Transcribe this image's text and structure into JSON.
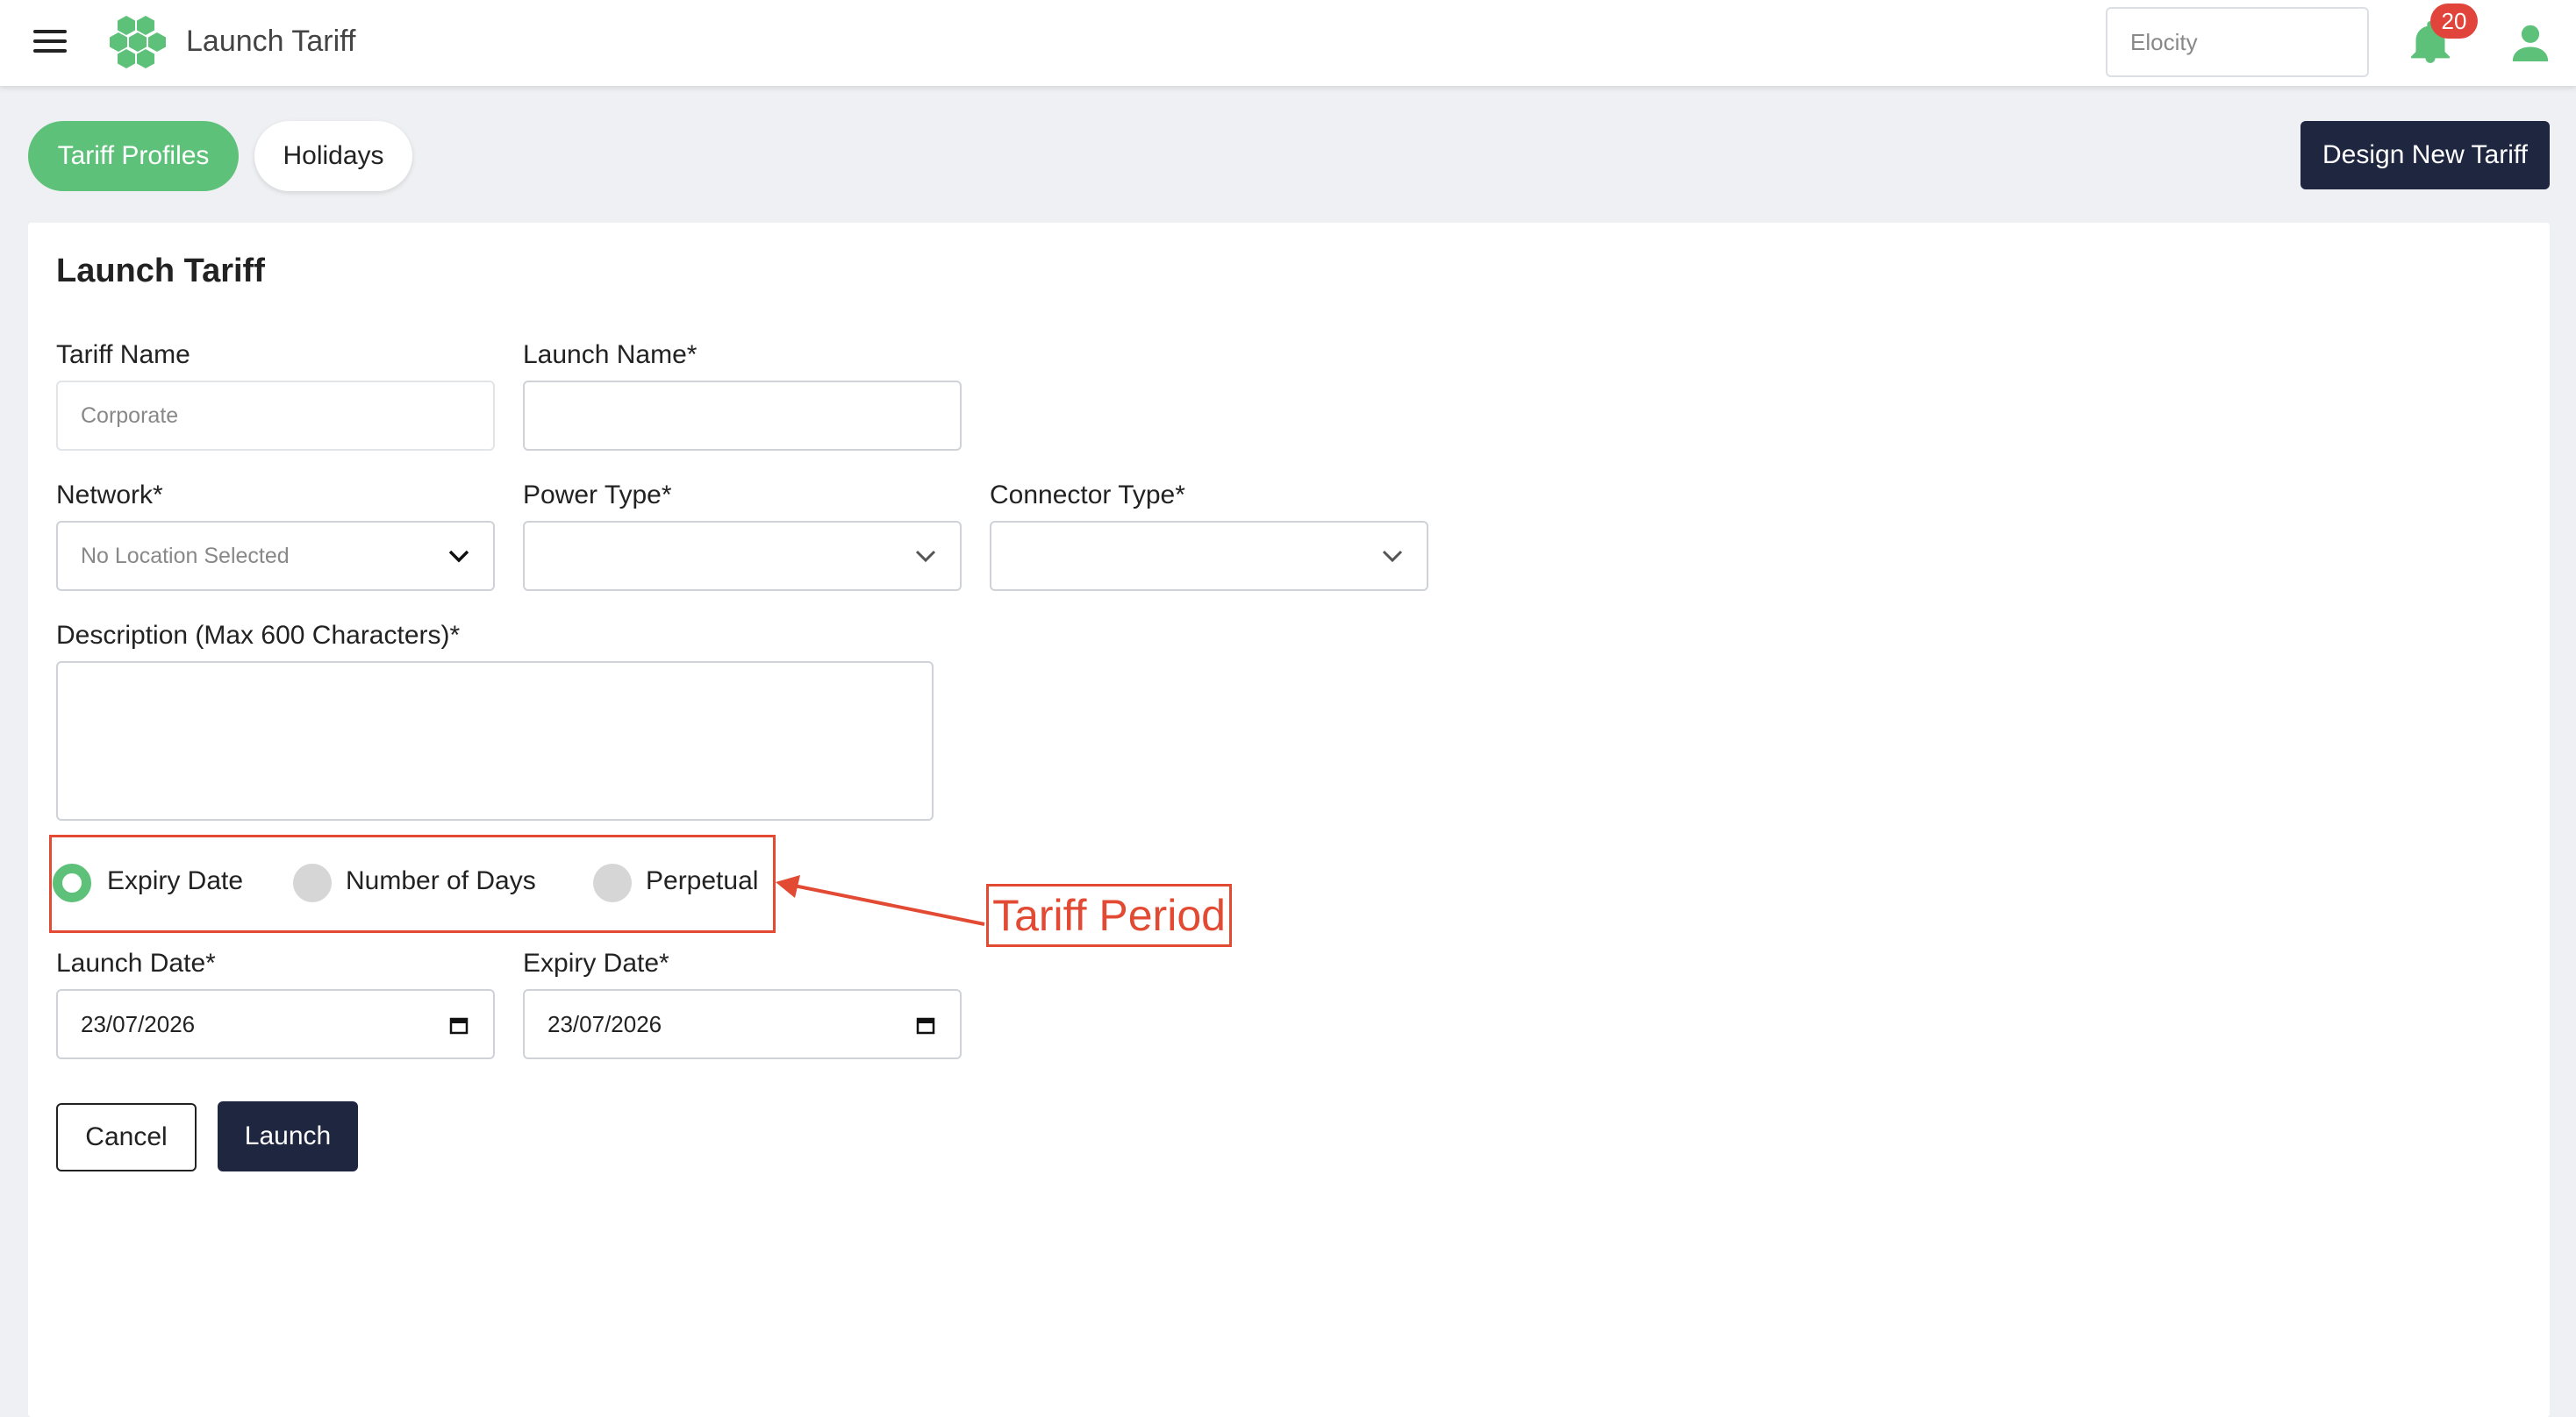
{
  "header": {
    "app_title": "Launch Tariff",
    "company_selector": "Elocity",
    "notification_count": "20",
    "icons": [
      "hamburger-menu-icon",
      "hexagon-logo-icon",
      "bell-icon",
      "user-icon"
    ]
  },
  "tabs": [
    {
      "label": "Tariff Profiles",
      "active": true
    },
    {
      "label": "Holidays",
      "active": false
    }
  ],
  "actions": {
    "design_new_tariff": "Design New Tariff"
  },
  "form": {
    "title": "Launch Tariff",
    "tariff_name": {
      "label": "Tariff Name",
      "value": "Corporate"
    },
    "launch_name": {
      "label": "Launch Name*",
      "value": ""
    },
    "network": {
      "label": "Network*",
      "selected": "No Location Selected"
    },
    "power_type": {
      "label": "Power Type*",
      "selected": ""
    },
    "connector_type": {
      "label": "Connector Type*",
      "selected": ""
    },
    "description": {
      "label": "Description (Max 600 Characters)*",
      "value": ""
    },
    "tariff_period": {
      "options": [
        "Expiry Date",
        "Number of Days",
        "Perpetual"
      ],
      "selected": "Expiry Date"
    },
    "launch_date": {
      "label": "Launch Date*",
      "value": "23/07/2026"
    },
    "expiry_date": {
      "label": "Expiry Date*",
      "value": "23/07/2026"
    },
    "cancel_label": "Cancel",
    "launch_label": "Launch"
  },
  "annotation": {
    "text": "Tariff Period",
    "color": "#e24a33"
  },
  "colors": {
    "accent_green": "#5ec179",
    "navy": "#1f2640",
    "badge_red": "#e0443a"
  }
}
